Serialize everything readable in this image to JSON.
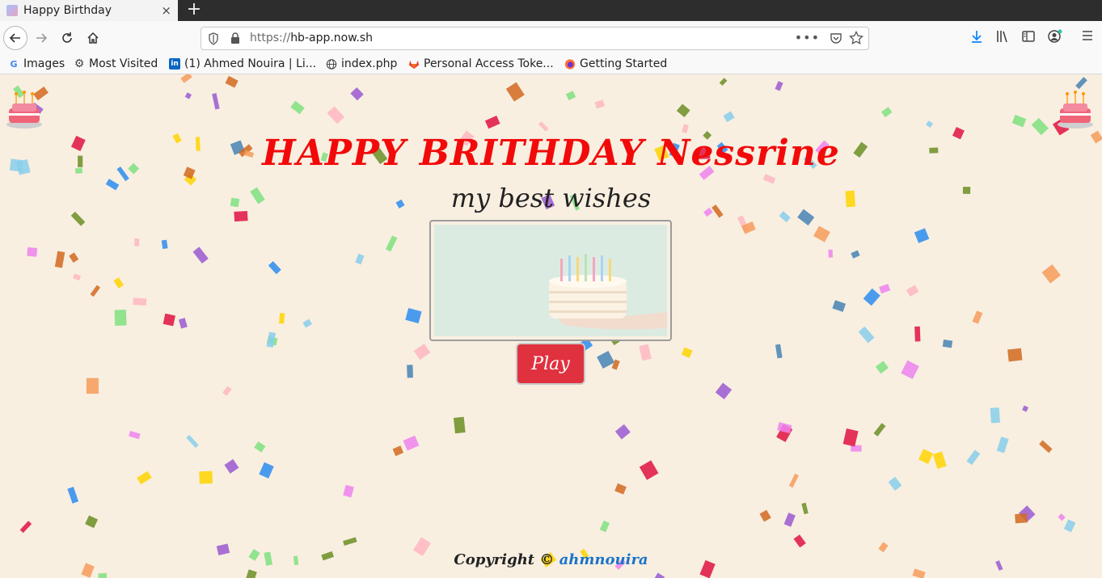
{
  "tab": {
    "title": "Happy Birthday",
    "close": "×",
    "new_tab": "+"
  },
  "nav": {
    "url_protocol": "https://",
    "url_host": "hb-app.now.sh",
    "more": "•••"
  },
  "bookmarks": [
    {
      "label": "Images",
      "icon": "google-icon"
    },
    {
      "label": "Most Visited",
      "icon": "gear-icon"
    },
    {
      "label": "(1) Ahmed Nouira | Li...",
      "icon": "linkedin-icon"
    },
    {
      "label": "index.php",
      "icon": "globe-icon"
    },
    {
      "label": "Personal Access Toke...",
      "icon": "gitlab-icon"
    },
    {
      "label": "Getting Started",
      "icon": "firefox-icon"
    }
  ],
  "page": {
    "title": "HAPPY BRITHDAY Nessrine",
    "subtitle": "my best wishes",
    "play_label": "Play",
    "footer_prefix": "Copyright © ",
    "footer_author": "ahmnouira"
  },
  "colors": {
    "page_bg": "#f8efe1",
    "title": "#f20a0a",
    "play_button": "#e0313f",
    "link": "#1a73c9"
  }
}
